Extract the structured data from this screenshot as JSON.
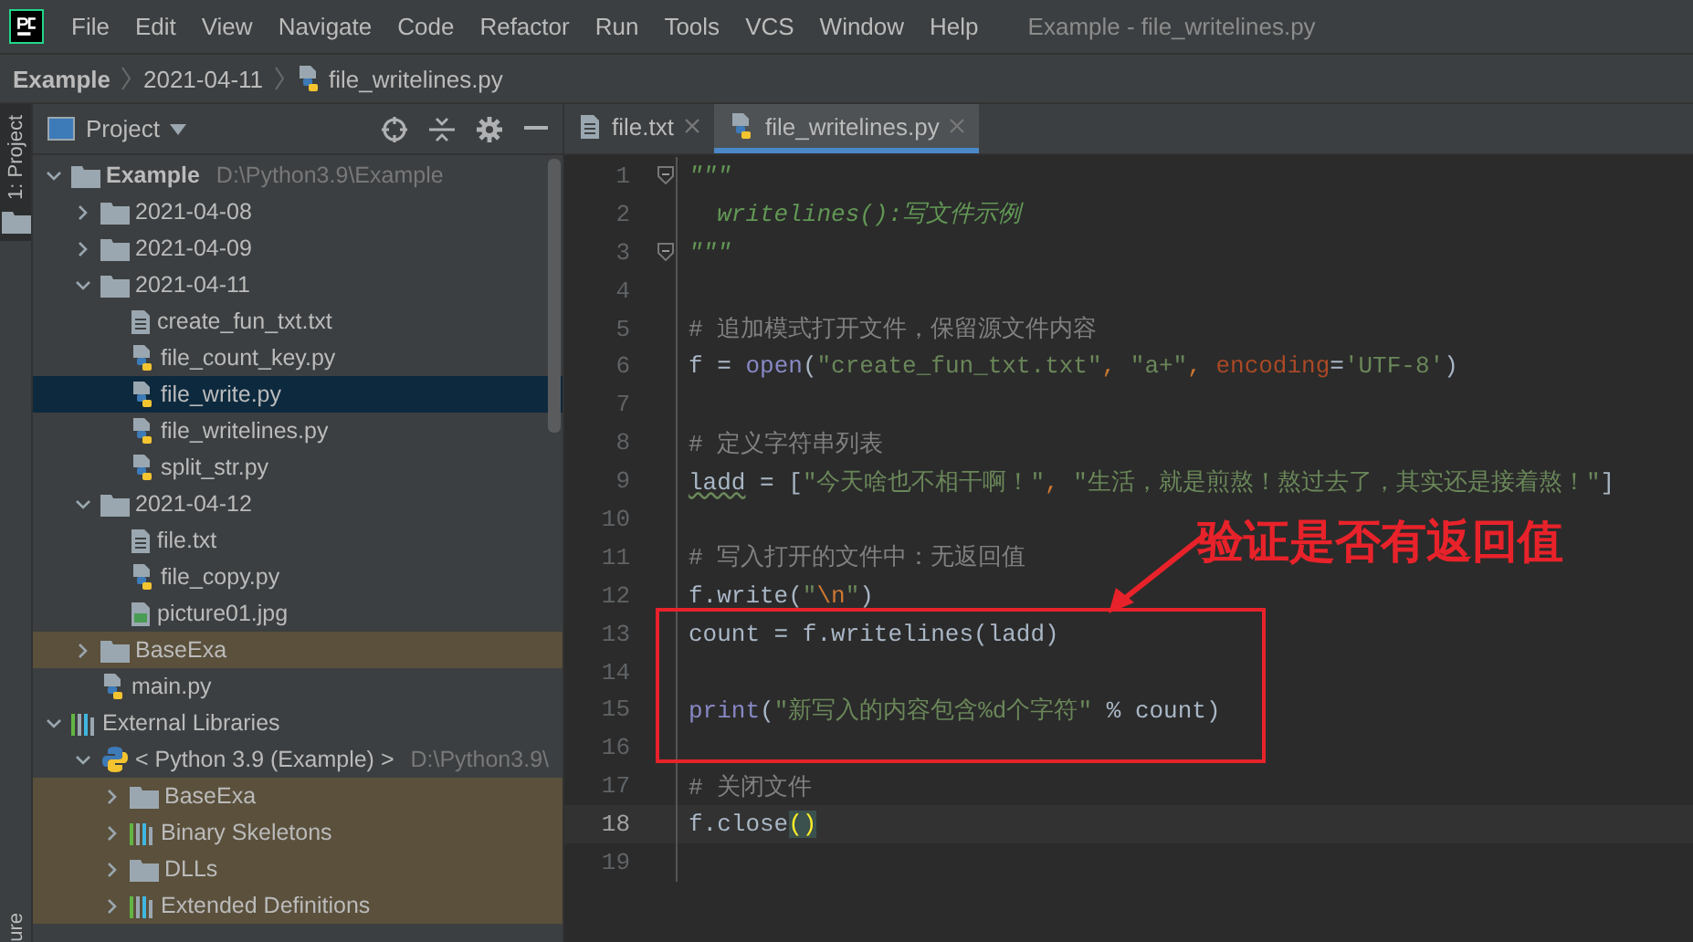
{
  "menu": [
    "File",
    "Edit",
    "View",
    "Navigate",
    "Code",
    "Refactor",
    "Run",
    "Tools",
    "VCS",
    "Window",
    "Help"
  ],
  "window": {
    "title": "Example - file_writelines.py"
  },
  "breadcrumb": [
    {
      "label": "Example",
      "kind": "project"
    },
    {
      "label": "2021-04-11",
      "kind": "folder"
    },
    {
      "label": "file_writelines.py",
      "kind": "py"
    }
  ],
  "side_strip": {
    "top": "1: Project",
    "bottom": "ure"
  },
  "project_panel": {
    "title": "Project",
    "tree": [
      {
        "name": "Example",
        "hint": "D:\\Python3.9\\Example",
        "kind": "folder",
        "bold": true,
        "expanded": true,
        "selected": false,
        "shaded": false,
        "children": [
          {
            "name": "2021-04-08",
            "kind": "folder",
            "expanded": false,
            "selected": false,
            "shaded": false
          },
          {
            "name": "2021-04-09",
            "kind": "folder",
            "expanded": false,
            "selected": false,
            "shaded": false
          },
          {
            "name": "2021-04-11",
            "kind": "folder",
            "expanded": true,
            "selected": false,
            "shaded": false,
            "children": [
              {
                "name": "create_fun_txt.txt",
                "kind": "txt",
                "selected": false,
                "shaded": false
              },
              {
                "name": "file_count_key.py",
                "kind": "py",
                "selected": false,
                "shaded": false
              },
              {
                "name": "file_write.py",
                "kind": "py",
                "selected": true,
                "shaded": false
              },
              {
                "name": "file_writelines.py",
                "kind": "py",
                "selected": false,
                "shaded": false
              },
              {
                "name": "split_str.py",
                "kind": "py",
                "selected": false,
                "shaded": false
              }
            ]
          },
          {
            "name": "2021-04-12",
            "kind": "folder",
            "expanded": true,
            "selected": false,
            "shaded": false,
            "children": [
              {
                "name": "file.txt",
                "kind": "txt",
                "selected": false,
                "shaded": false
              },
              {
                "name": "file_copy.py",
                "kind": "py",
                "selected": false,
                "shaded": false
              },
              {
                "name": "picture01.jpg",
                "kind": "image",
                "selected": false,
                "shaded": false
              }
            ]
          },
          {
            "name": "BaseExa",
            "kind": "folder",
            "expanded": false,
            "selected": false,
            "shaded": true
          },
          {
            "name": "main.py",
            "kind": "py",
            "selected": false,
            "shaded": false
          }
        ]
      },
      {
        "name": "External Libraries",
        "kind": "library",
        "expanded": true,
        "selected": false,
        "shaded": false,
        "children": [
          {
            "name": "< Python 3.9 (Example) >",
            "hint": "D:\\Python3.9\\",
            "kind": "python",
            "expanded": true,
            "selected": false,
            "shaded": false,
            "children": [
              {
                "name": "BaseExa",
                "kind": "folder",
                "expanded": false,
                "selected": false,
                "shaded": true
              },
              {
                "name": "Binary Skeletons",
                "kind": "library",
                "expanded": false,
                "selected": false,
                "shaded": true
              },
              {
                "name": "DLLs",
                "kind": "folder",
                "expanded": false,
                "selected": false,
                "shaded": true
              },
              {
                "name": "Extended Definitions",
                "kind": "library",
                "expanded": false,
                "selected": false,
                "shaded": true
              }
            ]
          }
        ]
      }
    ]
  },
  "editor_tabs": [
    {
      "label": "file.txt",
      "kind": "txt",
      "selected": false
    },
    {
      "label": "file_writelines.py",
      "kind": "py",
      "selected": true
    }
  ],
  "code": [
    {
      "number": "1",
      "fold": true,
      "current": false,
      "tokens": [
        {
          "kind": "doc",
          "text": "\"\"\""
        }
      ]
    },
    {
      "number": "2",
      "fold": false,
      "current": false,
      "tokens": [
        {
          "kind": "doc",
          "text": "  writelines():写文件示例"
        }
      ]
    },
    {
      "number": "3",
      "fold": true,
      "current": false,
      "tokens": [
        {
          "kind": "doc",
          "text": "\"\"\""
        }
      ]
    },
    {
      "number": "4",
      "fold": false,
      "current": false
    },
    {
      "number": "5",
      "fold": false,
      "current": false,
      "tokens": [
        {
          "kind": "comment",
          "text": "# 追加模式打开文件，保留源文件内容"
        }
      ]
    },
    {
      "number": "6",
      "fold": false,
      "current": false,
      "tokens": [
        {
          "kind": "plain",
          "text": "f = "
        },
        {
          "kind": "builtin",
          "text": "open"
        },
        {
          "kind": "plain",
          "text": "("
        },
        {
          "kind": "string",
          "text": "\"create_fun_txt.txt\""
        },
        {
          "kind": "punct",
          "text": ", "
        },
        {
          "kind": "string",
          "text": "\"a+\""
        },
        {
          "kind": "punct",
          "text": ", "
        },
        {
          "kind": "param",
          "text": "encoding"
        },
        {
          "kind": "plain",
          "text": "="
        },
        {
          "kind": "string",
          "text": "'UTF-8'"
        },
        {
          "kind": "plain",
          "text": ")"
        }
      ]
    },
    {
      "number": "7",
      "fold": false,
      "current": false
    },
    {
      "number": "8",
      "fold": false,
      "current": false,
      "tokens": [
        {
          "kind": "comment",
          "text": "# 定义字符串列表"
        }
      ]
    },
    {
      "number": "9",
      "fold": false,
      "current": false,
      "tokens": [
        {
          "kind": "warn",
          "text": "ladd"
        },
        {
          "kind": "plain",
          "text": " = ["
        },
        {
          "kind": "string",
          "text": "\"今天啥也不相干啊！\""
        },
        {
          "kind": "punct",
          "text": ", "
        },
        {
          "kind": "string",
          "text": "\"生活，就是煎熬！熬过去了，其实还是接着熬！\""
        },
        {
          "kind": "plain",
          "text": "]"
        }
      ]
    },
    {
      "number": "10",
      "fold": false,
      "current": false
    },
    {
      "number": "11",
      "fold": false,
      "current": false,
      "tokens": [
        {
          "kind": "comment",
          "text": "# 写入打开的文件中：无返回值"
        }
      ]
    },
    {
      "number": "12",
      "fold": false,
      "current": false,
      "tokens": [
        {
          "kind": "plain",
          "text": "f.write("
        },
        {
          "kind": "string",
          "text": "\""
        },
        {
          "kind": "escape",
          "text": "\\n"
        },
        {
          "kind": "string",
          "text": "\""
        },
        {
          "kind": "plain",
          "text": ")"
        }
      ]
    },
    {
      "number": "13",
      "fold": false,
      "current": false,
      "tokens": [
        {
          "kind": "plain",
          "text": "count = f.writelines(ladd)"
        }
      ]
    },
    {
      "number": "14",
      "fold": false,
      "current": false
    },
    {
      "number": "15",
      "fold": false,
      "current": false,
      "tokens": [
        {
          "kind": "builtin",
          "text": "print"
        },
        {
          "kind": "plain",
          "text": "("
        },
        {
          "kind": "string",
          "text": "\"新写入的内容包含%d个字符\""
        },
        {
          "kind": "plain",
          "text": " % count)"
        }
      ]
    },
    {
      "number": "16",
      "fold": false,
      "current": false
    },
    {
      "number": "17",
      "fold": false,
      "current": false,
      "tokens": [
        {
          "kind": "comment",
          "text": "# 关闭文件"
        }
      ]
    },
    {
      "number": "18",
      "fold": false,
      "current": true,
      "tokens": [
        {
          "kind": "plain",
          "text": "f.close"
        },
        {
          "kind": "match",
          "text": "()"
        }
      ]
    },
    {
      "number": "19",
      "fold": false,
      "current": false
    }
  ],
  "annotation": {
    "text": "验证是否有返回值"
  }
}
